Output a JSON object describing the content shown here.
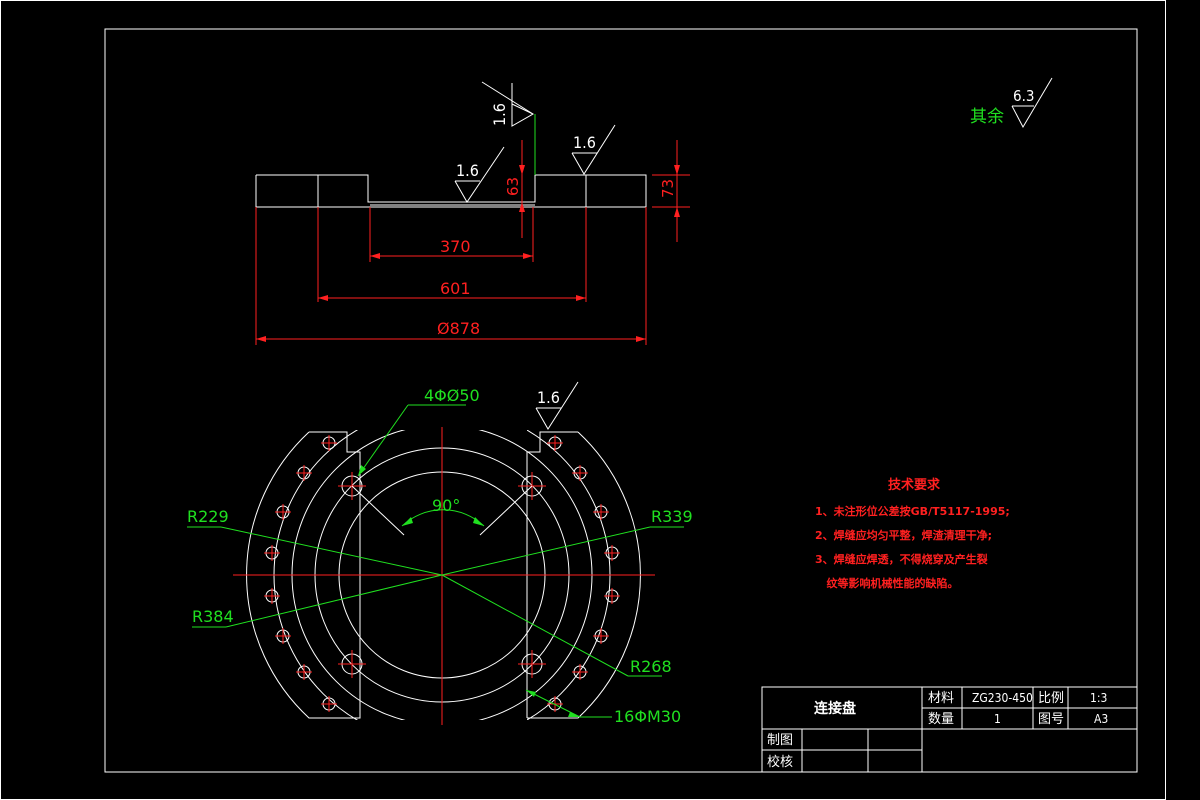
{
  "drawing": {
    "general_roughness_prefix": "其余",
    "general_roughness_value": "6.3",
    "roughness_top_vertical": "1.6",
    "roughness_side_right": "1.6",
    "roughness_side_slot": "1.6",
    "roughness_plan": "1.6",
    "dims": {
      "slot_depth": "63",
      "height": "73",
      "slot_width": "370",
      "inner_width": "601",
      "outer_diameter": "Ø878"
    },
    "plan": {
      "holes_4": "4ΦØ50",
      "angle": "90°",
      "r229": "R229",
      "r339": "R339",
      "r384": "R384",
      "r268": "R268",
      "holes_16": "16ΦM30"
    }
  },
  "tech_requirements": {
    "title": "技术要求",
    "items": [
      "1、未注形位公差按GB/T5117-1995;",
      "2、焊缝应均匀平整，焊渣清理干净;",
      "3、焊缝应焊透，不得烧穿及产生裂",
      "   纹等影响机械性能的缺陷。"
    ]
  },
  "title_block": {
    "part_name": "连接盘",
    "material_label": "材料",
    "material_value": "ZG230-450",
    "scale_label": "比例",
    "scale_value": "1:3",
    "quantity_label": "数量",
    "quantity_value": "1",
    "drawing_no_label": "图号",
    "drawing_no_value": "A3",
    "drawn_label": "制图",
    "checked_label": "校核"
  }
}
